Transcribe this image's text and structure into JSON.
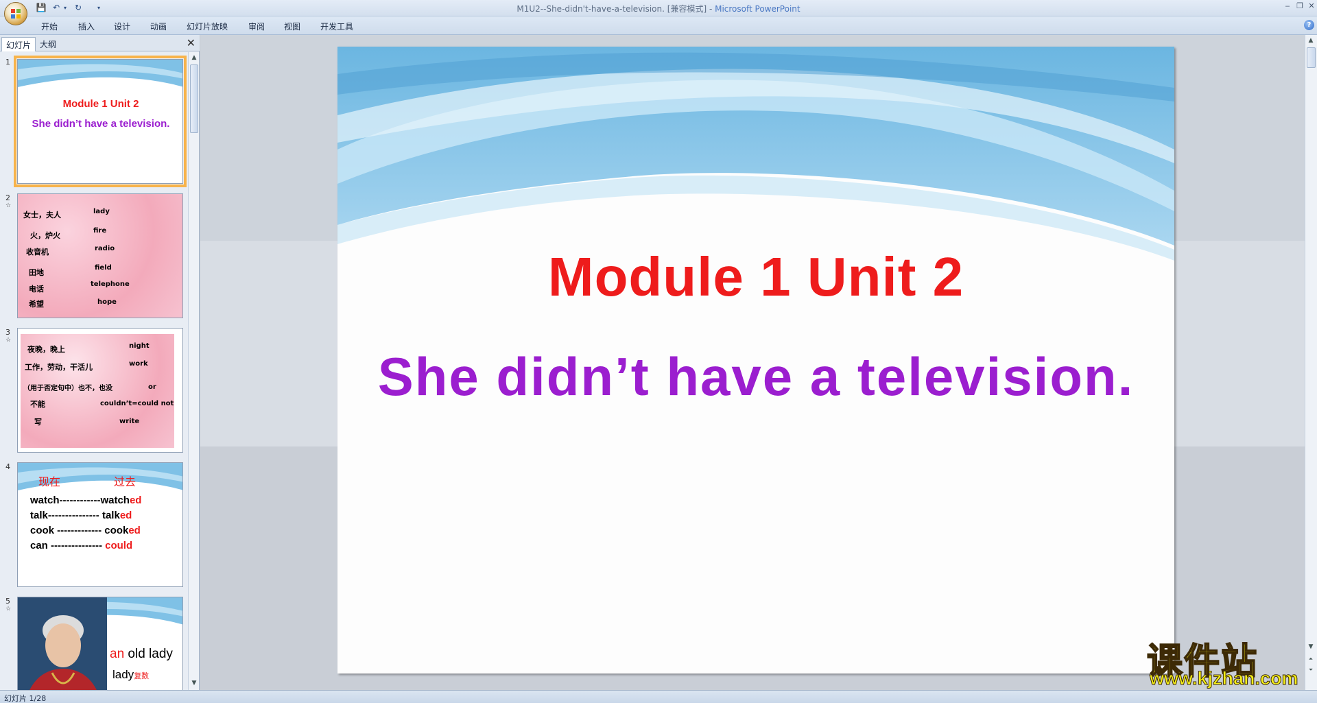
{
  "window": {
    "title": "M1U2--She-didn't-have-a-television. [兼容模式]",
    "title_separator": " - ",
    "app_name": "Microsoft PowerPoint"
  },
  "ribbon": {
    "tabs": [
      "开始",
      "插入",
      "设计",
      "动画",
      "幻灯片放映",
      "审阅",
      "视图",
      "开发工具"
    ]
  },
  "left_pane": {
    "tabs": [
      "幻灯片",
      "大纲"
    ],
    "close": "✕"
  },
  "thumbnails": {
    "numbers": [
      "1",
      "2",
      "3",
      "4",
      "5"
    ],
    "s1": {
      "title": "Module 1    Unit 2",
      "subtitle": "She didn’t have a television."
    },
    "s2": {
      "cn": [
        "女士，夫人",
        "火，炉火",
        "收音机",
        "田地",
        "电话",
        "希望"
      ],
      "en": [
        "lady",
        "fire",
        "radio",
        "field",
        "telephone",
        "hope"
      ]
    },
    "s3": {
      "cn": [
        "夜晚，晚上",
        "工作，劳动，干活儿",
        "（用于否定句中）也不，也没",
        "不能",
        "写"
      ],
      "en": [
        "night",
        "work",
        "or",
        "couldn’t=could  not",
        "write"
      ]
    },
    "s4": {
      "headers": [
        "现在",
        "过去"
      ],
      "rows": [
        {
          "base": "watch------------",
          "past": "watch",
          "suffix": "ed"
        },
        {
          "base": "talk---------------",
          "past": "talk",
          "suffix": "ed"
        },
        {
          "base": "cook -------------",
          "past": "cook",
          "suffix": "ed"
        },
        {
          "base": "can ---------------",
          "past": "",
          "suffix": "could"
        }
      ]
    },
    "s5": {
      "article": "an",
      "phrase": " old lady",
      "word": "lady",
      "note": "复数"
    }
  },
  "slide": {
    "title": "Module 1    Unit 2",
    "subtitle": "She didn’t have a television."
  },
  "status": {
    "text": "幻灯片 1/28"
  },
  "watermark": {
    "cn": "课件站",
    "url": "www.kjzhan.com"
  },
  "colors": {
    "title_red": "#ee1c1c",
    "subtitle_purple": "#9b1ecf",
    "selection": "#f7b34b"
  }
}
